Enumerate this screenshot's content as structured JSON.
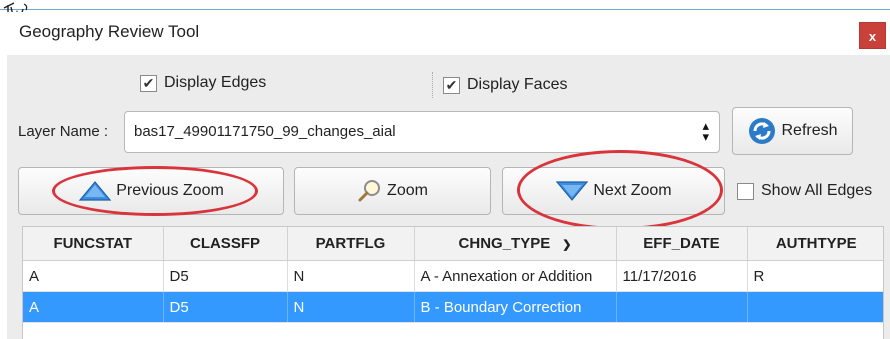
{
  "window": {
    "title": "Geography Review Tool",
    "close_label": "x"
  },
  "options": {
    "display_edges": {
      "label": "Display Edges",
      "checked": true
    },
    "display_faces": {
      "label": "Display Faces",
      "checked": true
    },
    "show_all_edges": {
      "label": "Show All Edges",
      "checked": false
    }
  },
  "layer": {
    "label": "Layer Name :",
    "value": "bas17_49901171750_99_changes_aial"
  },
  "buttons": {
    "refresh": "Refresh",
    "previous_zoom": "Previous Zoom",
    "zoom": "Zoom",
    "next_zoom": "Next Zoom"
  },
  "table": {
    "columns": [
      "FUNCSTAT",
      "CLASSFP",
      "PARTFLG",
      "CHNG_TYPE",
      "EFF_DATE",
      "AUTHTYPE"
    ],
    "rows": [
      [
        "A",
        "D5",
        "N",
        "A - Annexation or Addition",
        "11/17/2016",
        "R"
      ],
      [
        "A",
        "D5",
        "N",
        "B - Boundary Correction",
        "",
        ""
      ]
    ],
    "selected_row": 1
  },
  "colors": {
    "selection": "#3399ff",
    "highlight_ellipse": "#d9343c",
    "close_button": "#c9413a"
  }
}
